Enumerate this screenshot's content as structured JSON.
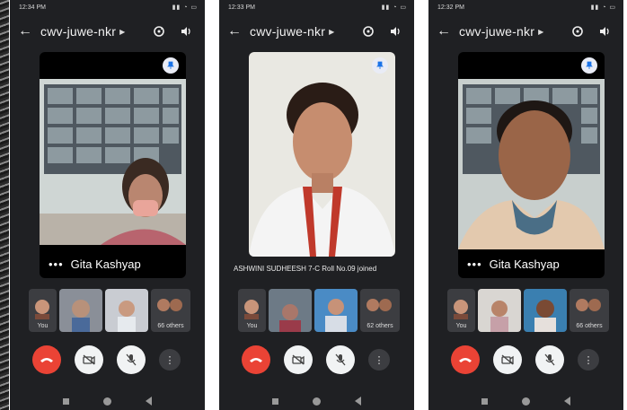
{
  "screens": [
    {
      "status_time": "12:34 PM",
      "meeting_code": "cwv-juwe-nkr",
      "speaker_name": "Gita Kashyap",
      "toast": "",
      "self_label": "You",
      "others_label": "66 others"
    },
    {
      "status_time": "12:33 PM",
      "meeting_code": "cwv-juwe-nkr",
      "speaker_name": "",
      "toast": "ASHWINI SUDHEESH 7-C Roll No.09 joined",
      "self_label": "You",
      "others_label": "62 others"
    },
    {
      "status_time": "12:32 PM",
      "meeting_code": "cwv-juwe-nkr",
      "speaker_name": "Gita Kashyap",
      "toast": "",
      "self_label": "You",
      "others_label": "66 others"
    }
  ],
  "icons": {
    "back": "arrow-left-icon",
    "switch_camera": "switch-camera-icon",
    "speaker": "volume-icon",
    "pin": "pin-icon",
    "end_call": "end-call-icon",
    "camera_off": "camera-off-icon",
    "mic_off": "mic-off-icon",
    "more": "more-vert-icon"
  },
  "colors": {
    "app_background": "#1f2023",
    "end_call": "#ea4335",
    "control_bg": "#f1f3f4"
  }
}
